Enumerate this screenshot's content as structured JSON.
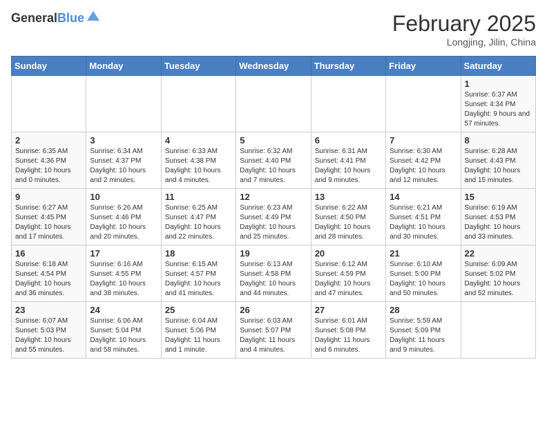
{
  "logo": {
    "general": "General",
    "blue": "Blue"
  },
  "title": "February 2025",
  "location": "Longjing, Jilin, China",
  "days_of_week": [
    "Sunday",
    "Monday",
    "Tuesday",
    "Wednesday",
    "Thursday",
    "Friday",
    "Saturday"
  ],
  "weeks": [
    [
      {
        "day": "",
        "info": ""
      },
      {
        "day": "",
        "info": ""
      },
      {
        "day": "",
        "info": ""
      },
      {
        "day": "",
        "info": ""
      },
      {
        "day": "",
        "info": ""
      },
      {
        "day": "",
        "info": ""
      },
      {
        "day": "1",
        "info": "Sunrise: 6:37 AM\nSunset: 4:34 PM\nDaylight: 9 hours and 57 minutes."
      }
    ],
    [
      {
        "day": "2",
        "info": "Sunrise: 6:35 AM\nSunset: 4:36 PM\nDaylight: 10 hours and 0 minutes."
      },
      {
        "day": "3",
        "info": "Sunrise: 6:34 AM\nSunset: 4:37 PM\nDaylight: 10 hours and 2 minutes."
      },
      {
        "day": "4",
        "info": "Sunrise: 6:33 AM\nSunset: 4:38 PM\nDaylight: 10 hours and 4 minutes."
      },
      {
        "day": "5",
        "info": "Sunrise: 6:32 AM\nSunset: 4:40 PM\nDaylight: 10 hours and 7 minutes."
      },
      {
        "day": "6",
        "info": "Sunrise: 6:31 AM\nSunset: 4:41 PM\nDaylight: 10 hours and 9 minutes."
      },
      {
        "day": "7",
        "info": "Sunrise: 6:30 AM\nSunset: 4:42 PM\nDaylight: 10 hours and 12 minutes."
      },
      {
        "day": "8",
        "info": "Sunrise: 6:28 AM\nSunset: 4:43 PM\nDaylight: 10 hours and 15 minutes."
      }
    ],
    [
      {
        "day": "9",
        "info": "Sunrise: 6:27 AM\nSunset: 4:45 PM\nDaylight: 10 hours and 17 minutes."
      },
      {
        "day": "10",
        "info": "Sunrise: 6:26 AM\nSunset: 4:46 PM\nDaylight: 10 hours and 20 minutes."
      },
      {
        "day": "11",
        "info": "Sunrise: 6:25 AM\nSunset: 4:47 PM\nDaylight: 10 hours and 22 minutes."
      },
      {
        "day": "12",
        "info": "Sunrise: 6:23 AM\nSunset: 4:49 PM\nDaylight: 10 hours and 25 minutes."
      },
      {
        "day": "13",
        "info": "Sunrise: 6:22 AM\nSunset: 4:50 PM\nDaylight: 10 hours and 28 minutes."
      },
      {
        "day": "14",
        "info": "Sunrise: 6:21 AM\nSunset: 4:51 PM\nDaylight: 10 hours and 30 minutes."
      },
      {
        "day": "15",
        "info": "Sunrise: 6:19 AM\nSunset: 4:53 PM\nDaylight: 10 hours and 33 minutes."
      }
    ],
    [
      {
        "day": "16",
        "info": "Sunrise: 6:18 AM\nSunset: 4:54 PM\nDaylight: 10 hours and 36 minutes."
      },
      {
        "day": "17",
        "info": "Sunrise: 6:16 AM\nSunset: 4:55 PM\nDaylight: 10 hours and 38 minutes."
      },
      {
        "day": "18",
        "info": "Sunrise: 6:15 AM\nSunset: 4:57 PM\nDaylight: 10 hours and 41 minutes."
      },
      {
        "day": "19",
        "info": "Sunrise: 6:13 AM\nSunset: 4:58 PM\nDaylight: 10 hours and 44 minutes."
      },
      {
        "day": "20",
        "info": "Sunrise: 6:12 AM\nSunset: 4:59 PM\nDaylight: 10 hours and 47 minutes."
      },
      {
        "day": "21",
        "info": "Sunrise: 6:10 AM\nSunset: 5:00 PM\nDaylight: 10 hours and 50 minutes."
      },
      {
        "day": "22",
        "info": "Sunrise: 6:09 AM\nSunset: 5:02 PM\nDaylight: 10 hours and 52 minutes."
      }
    ],
    [
      {
        "day": "23",
        "info": "Sunrise: 6:07 AM\nSunset: 5:03 PM\nDaylight: 10 hours and 55 minutes."
      },
      {
        "day": "24",
        "info": "Sunrise: 6:06 AM\nSunset: 5:04 PM\nDaylight: 10 hours and 58 minutes."
      },
      {
        "day": "25",
        "info": "Sunrise: 6:04 AM\nSunset: 5:06 PM\nDaylight: 11 hours and 1 minute."
      },
      {
        "day": "26",
        "info": "Sunrise: 6:03 AM\nSunset: 5:07 PM\nDaylight: 11 hours and 4 minutes."
      },
      {
        "day": "27",
        "info": "Sunrise: 6:01 AM\nSunset: 5:08 PM\nDaylight: 11 hours and 6 minutes."
      },
      {
        "day": "28",
        "info": "Sunrise: 5:59 AM\nSunset: 5:09 PM\nDaylight: 11 hours and 9 minutes."
      },
      {
        "day": "",
        "info": ""
      }
    ]
  ]
}
